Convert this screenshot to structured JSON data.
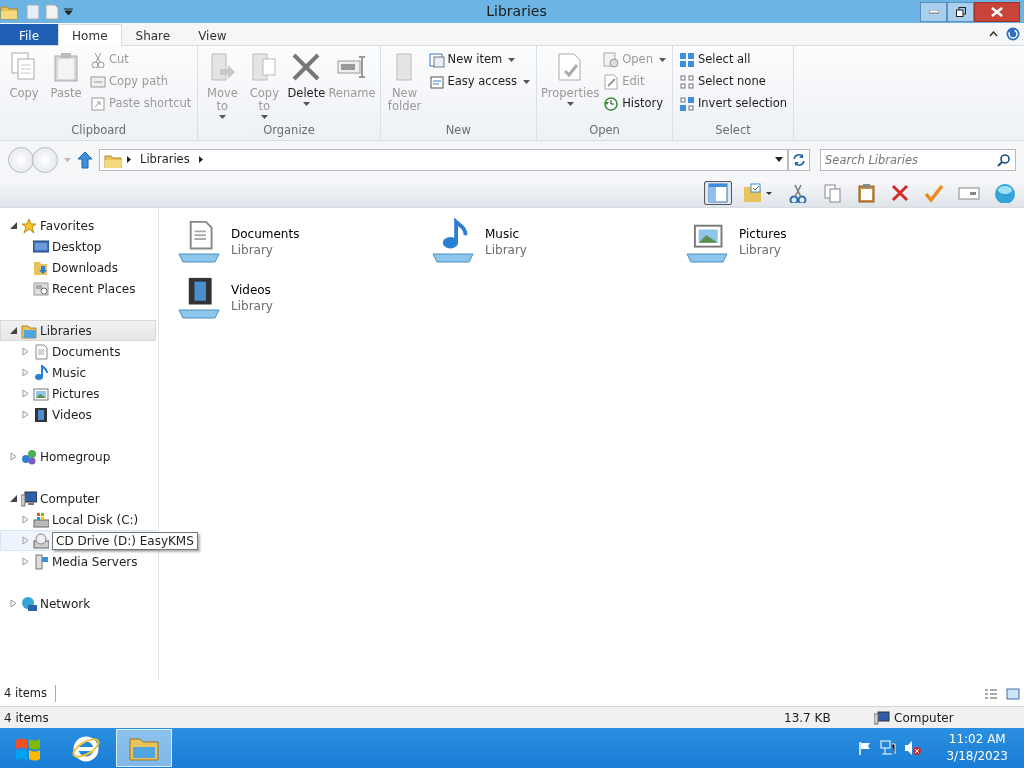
{
  "window": {
    "title": "Libraries"
  },
  "ribbon_tabs": [
    {
      "label": "File",
      "kind": "file",
      "selected": false
    },
    {
      "label": "Home",
      "kind": "tab",
      "selected": true
    },
    {
      "label": "Share",
      "kind": "tab",
      "selected": false
    },
    {
      "label": "View",
      "kind": "tab",
      "selected": false
    }
  ],
  "ribbon_groups": [
    {
      "label": "Clipboard",
      "items": [
        {
          "kind": "large",
          "label": "Copy",
          "disabled": true
        },
        {
          "kind": "large",
          "label": "Paste",
          "disabled": true
        },
        {
          "kind": "stack",
          "items": [
            {
              "label": "Cut",
              "disabled": true
            },
            {
              "label": "Copy path",
              "disabled": true
            },
            {
              "label": "Paste shortcut",
              "disabled": true
            }
          ]
        }
      ]
    },
    {
      "label": "Organize",
      "items": [
        {
          "kind": "large",
          "label": "Move to",
          "disabled": true,
          "dropdown": true
        },
        {
          "kind": "large",
          "label": "Copy to",
          "disabled": true,
          "dropdown": true
        },
        {
          "kind": "large",
          "label": "Delete",
          "disabled": false,
          "dropdown": true
        },
        {
          "kind": "large",
          "label": "Rename",
          "disabled": true
        }
      ]
    },
    {
      "label": "New",
      "items": [
        {
          "kind": "large",
          "label": "New folder",
          "disabled": true
        },
        {
          "kind": "stack",
          "items": [
            {
              "label": "New item",
              "disabled": false,
              "dropdown": true
            },
            {
              "label": "Easy access",
              "disabled": false,
              "dropdown": true
            }
          ]
        }
      ]
    },
    {
      "label": "Open",
      "items": [
        {
          "kind": "large",
          "label": "Properties",
          "disabled": true,
          "dropdown": true
        },
        {
          "kind": "stack",
          "items": [
            {
              "label": "Open",
              "disabled": true,
              "dropdown": true
            },
            {
              "label": "Edit",
              "disabled": true
            },
            {
              "label": "History",
              "disabled": false
            }
          ]
        }
      ]
    },
    {
      "label": "Select",
      "items": [
        {
          "kind": "stack",
          "items": [
            {
              "label": "Select all",
              "disabled": false
            },
            {
              "label": "Select none",
              "disabled": false
            },
            {
              "label": "Invert selection",
              "disabled": false
            }
          ]
        }
      ]
    }
  ],
  "address": {
    "crumbs": [
      "Libraries"
    ]
  },
  "search": {
    "placeholder": "Search Libraries"
  },
  "toolbar": {
    "preview_pane_on": true
  },
  "nav_tree": [
    {
      "label": "Favorites",
      "kind": "star",
      "expanded": true,
      "selected": false,
      "children": [
        {
          "label": "Desktop",
          "kind": "desktop",
          "selected": false
        },
        {
          "label": "Downloads",
          "kind": "download",
          "selected": false
        },
        {
          "label": "Recent Places",
          "kind": "recent",
          "selected": false
        }
      ]
    },
    {
      "label": "Libraries",
      "kind": "library",
      "expanded": true,
      "selected": true,
      "children": [
        {
          "label": "Documents",
          "kind": "doc",
          "expanded": false,
          "selected": false
        },
        {
          "label": "Music",
          "kind": "music",
          "expanded": false,
          "selected": false
        },
        {
          "label": "Pictures",
          "kind": "picture",
          "expanded": false,
          "selected": false
        },
        {
          "label": "Videos",
          "kind": "video",
          "expanded": false,
          "selected": false
        }
      ]
    },
    {
      "label": "Homegroup",
      "kind": "homegroup",
      "expanded": false,
      "selected": false
    },
    {
      "label": "Computer",
      "kind": "computer",
      "expanded": true,
      "selected": false,
      "children": [
        {
          "label": "Local Disk (C:)",
          "kind": "disk",
          "expanded": false,
          "selected": false
        },
        {
          "tooltip": "CD Drive (D:) EasyKMS",
          "kind": "cd",
          "expanded": false,
          "selected": false,
          "hovered": true
        },
        {
          "label": "Media Servers",
          "kind": "media",
          "expanded": false,
          "selected": false
        }
      ]
    },
    {
      "label": "Network",
      "kind": "network",
      "expanded": false,
      "selected": false
    }
  ],
  "items": [
    {
      "name": "Documents",
      "type": "Library",
      "kind": "doc"
    },
    {
      "name": "Music",
      "type": "Library",
      "kind": "music"
    },
    {
      "name": "Pictures",
      "type": "Library",
      "kind": "picture"
    },
    {
      "name": "Videos",
      "type": "Library",
      "kind": "video"
    }
  ],
  "details_bar": {
    "count": "4 items"
  },
  "status_bar": {
    "count": "4 items",
    "size": "13.7 KB",
    "location": "Computer"
  },
  "taskbar": {
    "apps": [
      {
        "kind": "ie",
        "active": false
      },
      {
        "kind": "explorer",
        "active": true
      }
    ],
    "time": "11:02 AM",
    "date": "3/18/2023"
  }
}
